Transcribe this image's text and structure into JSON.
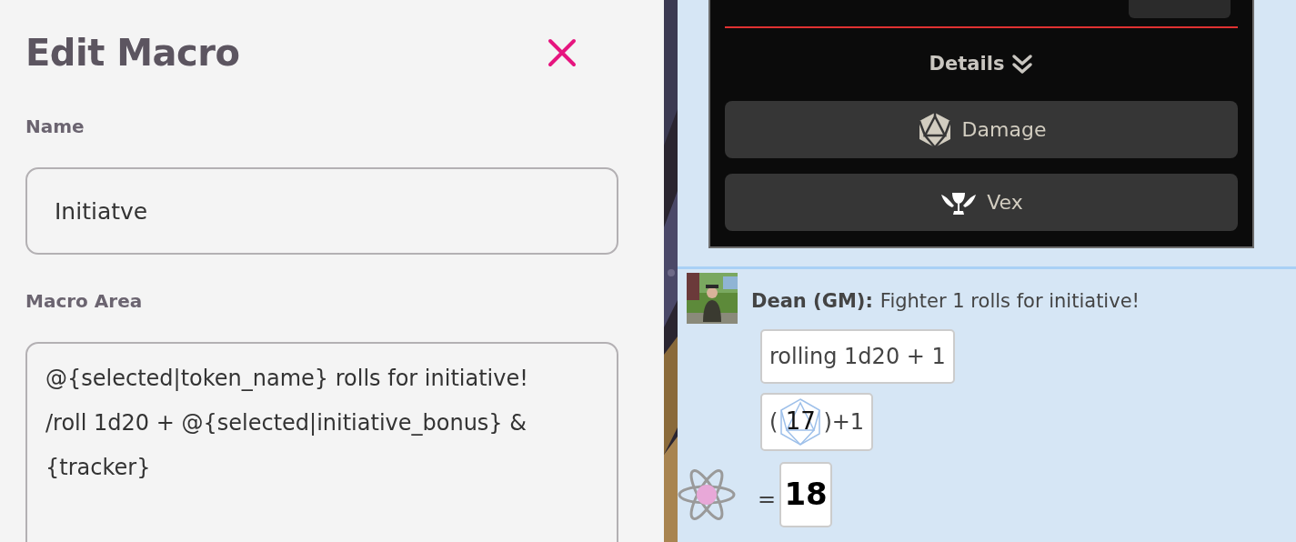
{
  "dialog": {
    "title": "Edit Macro",
    "fields": [
      {
        "kind": "input",
        "label": "Name",
        "value": "Initiatve"
      },
      {
        "kind": "textarea",
        "label": "Macro Area",
        "value": "@{selected|token_name} rolls for initiative!\n/roll 1d20 + @{selected|initiative_bonus} &\n{tracker}"
      }
    ]
  },
  "card": {
    "details": "Details",
    "buttons": [
      {
        "kind": "d20",
        "label": "Damage"
      },
      {
        "kind": "chalice",
        "label": "Vex"
      }
    ]
  },
  "message": {
    "sender": "Dean (GM):",
    "text": "Fighter 1 rolls for initiative!",
    "formula": "rolling 1d20 + 1",
    "roll_open": "(",
    "die": "17",
    "roll_close": ")+1",
    "equals": "=",
    "total": "18"
  }
}
